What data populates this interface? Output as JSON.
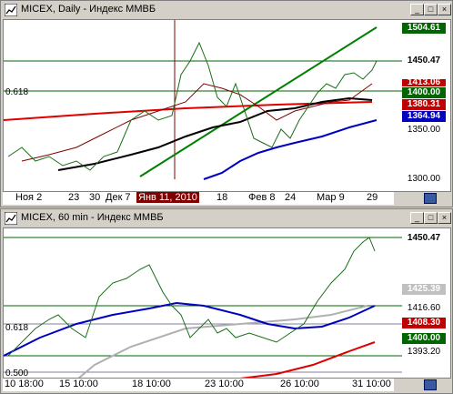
{
  "top": {
    "title": "MICEX, Daily - Индекс ММВБ",
    "prices": {
      "p1": "1504.61",
      "p2": "1450.47",
      "p3": "1413.06",
      "p4": "1400.00",
      "p5": "1380.31",
      "p6": "1364.94",
      "p7": "1350.00",
      "p8": "1300.00"
    },
    "fib": "0.618",
    "xlabels": [
      "Ноя 2",
      "23",
      "30",
      "Дек 7",
      "Янв 11, 2010",
      "18",
      "Фев 8",
      "24",
      "Мар 9",
      "29"
    ]
  },
  "bottom": {
    "title": "MICEX, 60 min - Индекс ММВБ",
    "prices": {
      "p1": "1450.47",
      "p2": "1425.39",
      "p3": "1416.60",
      "p4": "1408.30",
      "p5": "1400.00",
      "p6": "1393.20"
    },
    "fib1": "0.618",
    "fib2": "0.500",
    "xlabels": [
      "10 18:00",
      "15 10:00",
      "18 10:00",
      "23 10:00",
      "26 10:00",
      "31 10:00"
    ]
  },
  "colors": {
    "green_price": "#006400",
    "red_price": "#c00000",
    "blue_price": "#0000c0",
    "cursor_label_bg": "#800000"
  }
}
